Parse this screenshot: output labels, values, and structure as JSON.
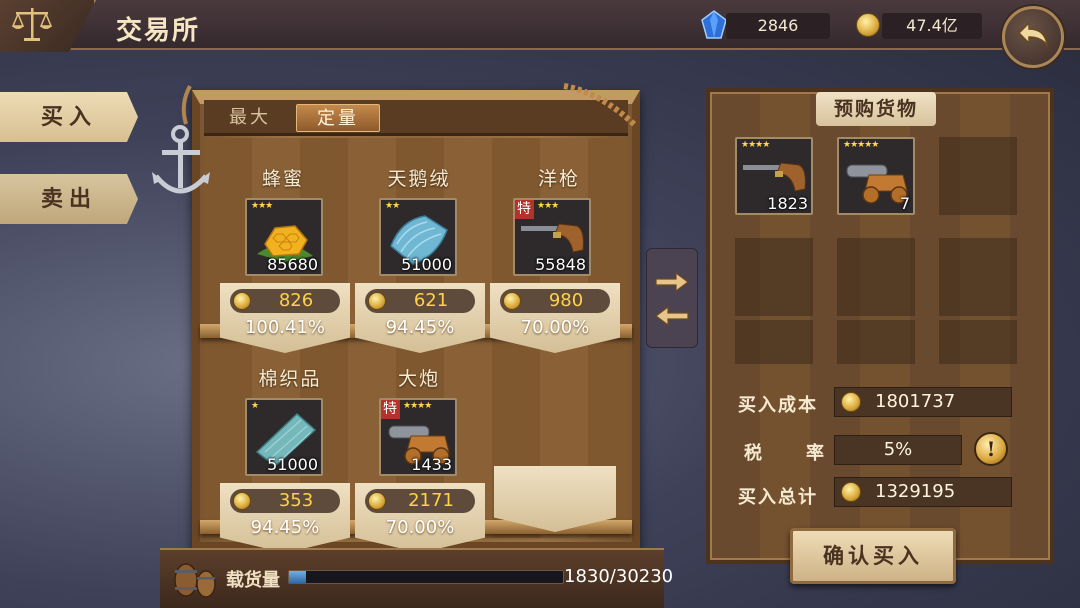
{
  "header": {
    "title": "交易所",
    "gems": "2846",
    "gold": "47.4亿"
  },
  "tabs": [
    {
      "label": "买入"
    },
    {
      "label": "卖出"
    }
  ],
  "modes": [
    {
      "label": "最大"
    },
    {
      "label": "定量"
    }
  ],
  "goods": [
    {
      "name": "蜂蜜",
      "stars": "★★★",
      "quantity": "85680",
      "price": "826",
      "percent": "100.41%",
      "special": false,
      "icon": "honeycomb-icon"
    },
    {
      "name": "天鹅绒",
      "stars": "★★",
      "quantity": "51000",
      "price": "621",
      "percent": "94.45%",
      "special": false,
      "icon": "velvet-cloth-icon"
    },
    {
      "name": "洋枪",
      "stars": "★★★",
      "quantity": "55848",
      "price": "980",
      "percent": "70.00%",
      "special": true,
      "special_label": "特",
      "icon": "musket-icon"
    },
    {
      "name": "棉织品",
      "stars": "★",
      "quantity": "51000",
      "price": "353",
      "percent": "94.45%",
      "special": false,
      "icon": "cotton-cloth-icon"
    },
    {
      "name": "大炮",
      "stars": "★★★★",
      "quantity": "1433",
      "price": "2171",
      "percent": "70.00%",
      "special": true,
      "special_label": "特",
      "icon": "cannon-icon"
    }
  ],
  "cargo": {
    "label": "载货量",
    "text": "1830/30230",
    "fill_fraction": 0.0605
  },
  "order": {
    "title": "预购货物",
    "items": [
      {
        "stars": "★★★★",
        "quantity": "1823",
        "icon": "musket-icon"
      },
      {
        "stars": "★★★★★",
        "quantity": "7",
        "icon": "cannon-icon"
      }
    ],
    "cost_label": "买入成本",
    "cost_value": "1801737",
    "tax_label_1": "税",
    "tax_label_2": "率",
    "tax_value": "5%",
    "total_label": "买入总计",
    "total_value": "1329195",
    "info_label": "!",
    "confirm_label": "确认买入"
  },
  "colors": {
    "gold_text": "#ffd24a",
    "parchment": "#efdcb6",
    "wood": "#8f673c"
  }
}
